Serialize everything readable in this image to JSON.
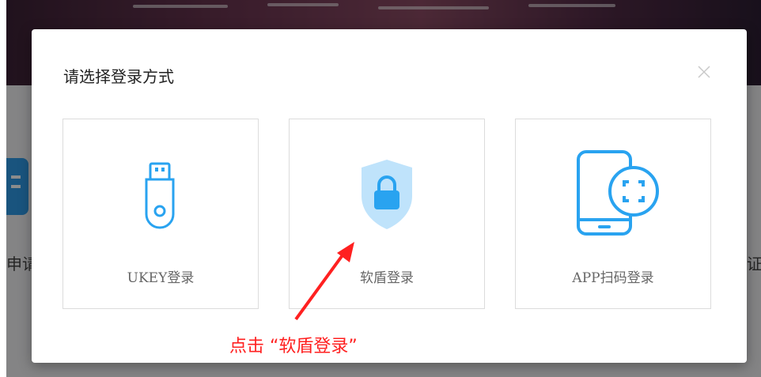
{
  "background": {
    "left_partial_text": "申请",
    "right_partial_text": "证"
  },
  "modal": {
    "title": "请选择登录方式",
    "close_icon": "close-icon"
  },
  "options": [
    {
      "label": "UKEY登录",
      "icon": "usb-key-icon"
    },
    {
      "label": "软盾登录",
      "icon": "shield-lock-icon"
    },
    {
      "label": "APP扫码登录",
      "icon": "phone-scan-icon"
    }
  ],
  "annotation": {
    "text": "点击 “软盾登录”"
  },
  "colors": {
    "accent": "#29a3f0",
    "annotation": "#ff2020"
  }
}
